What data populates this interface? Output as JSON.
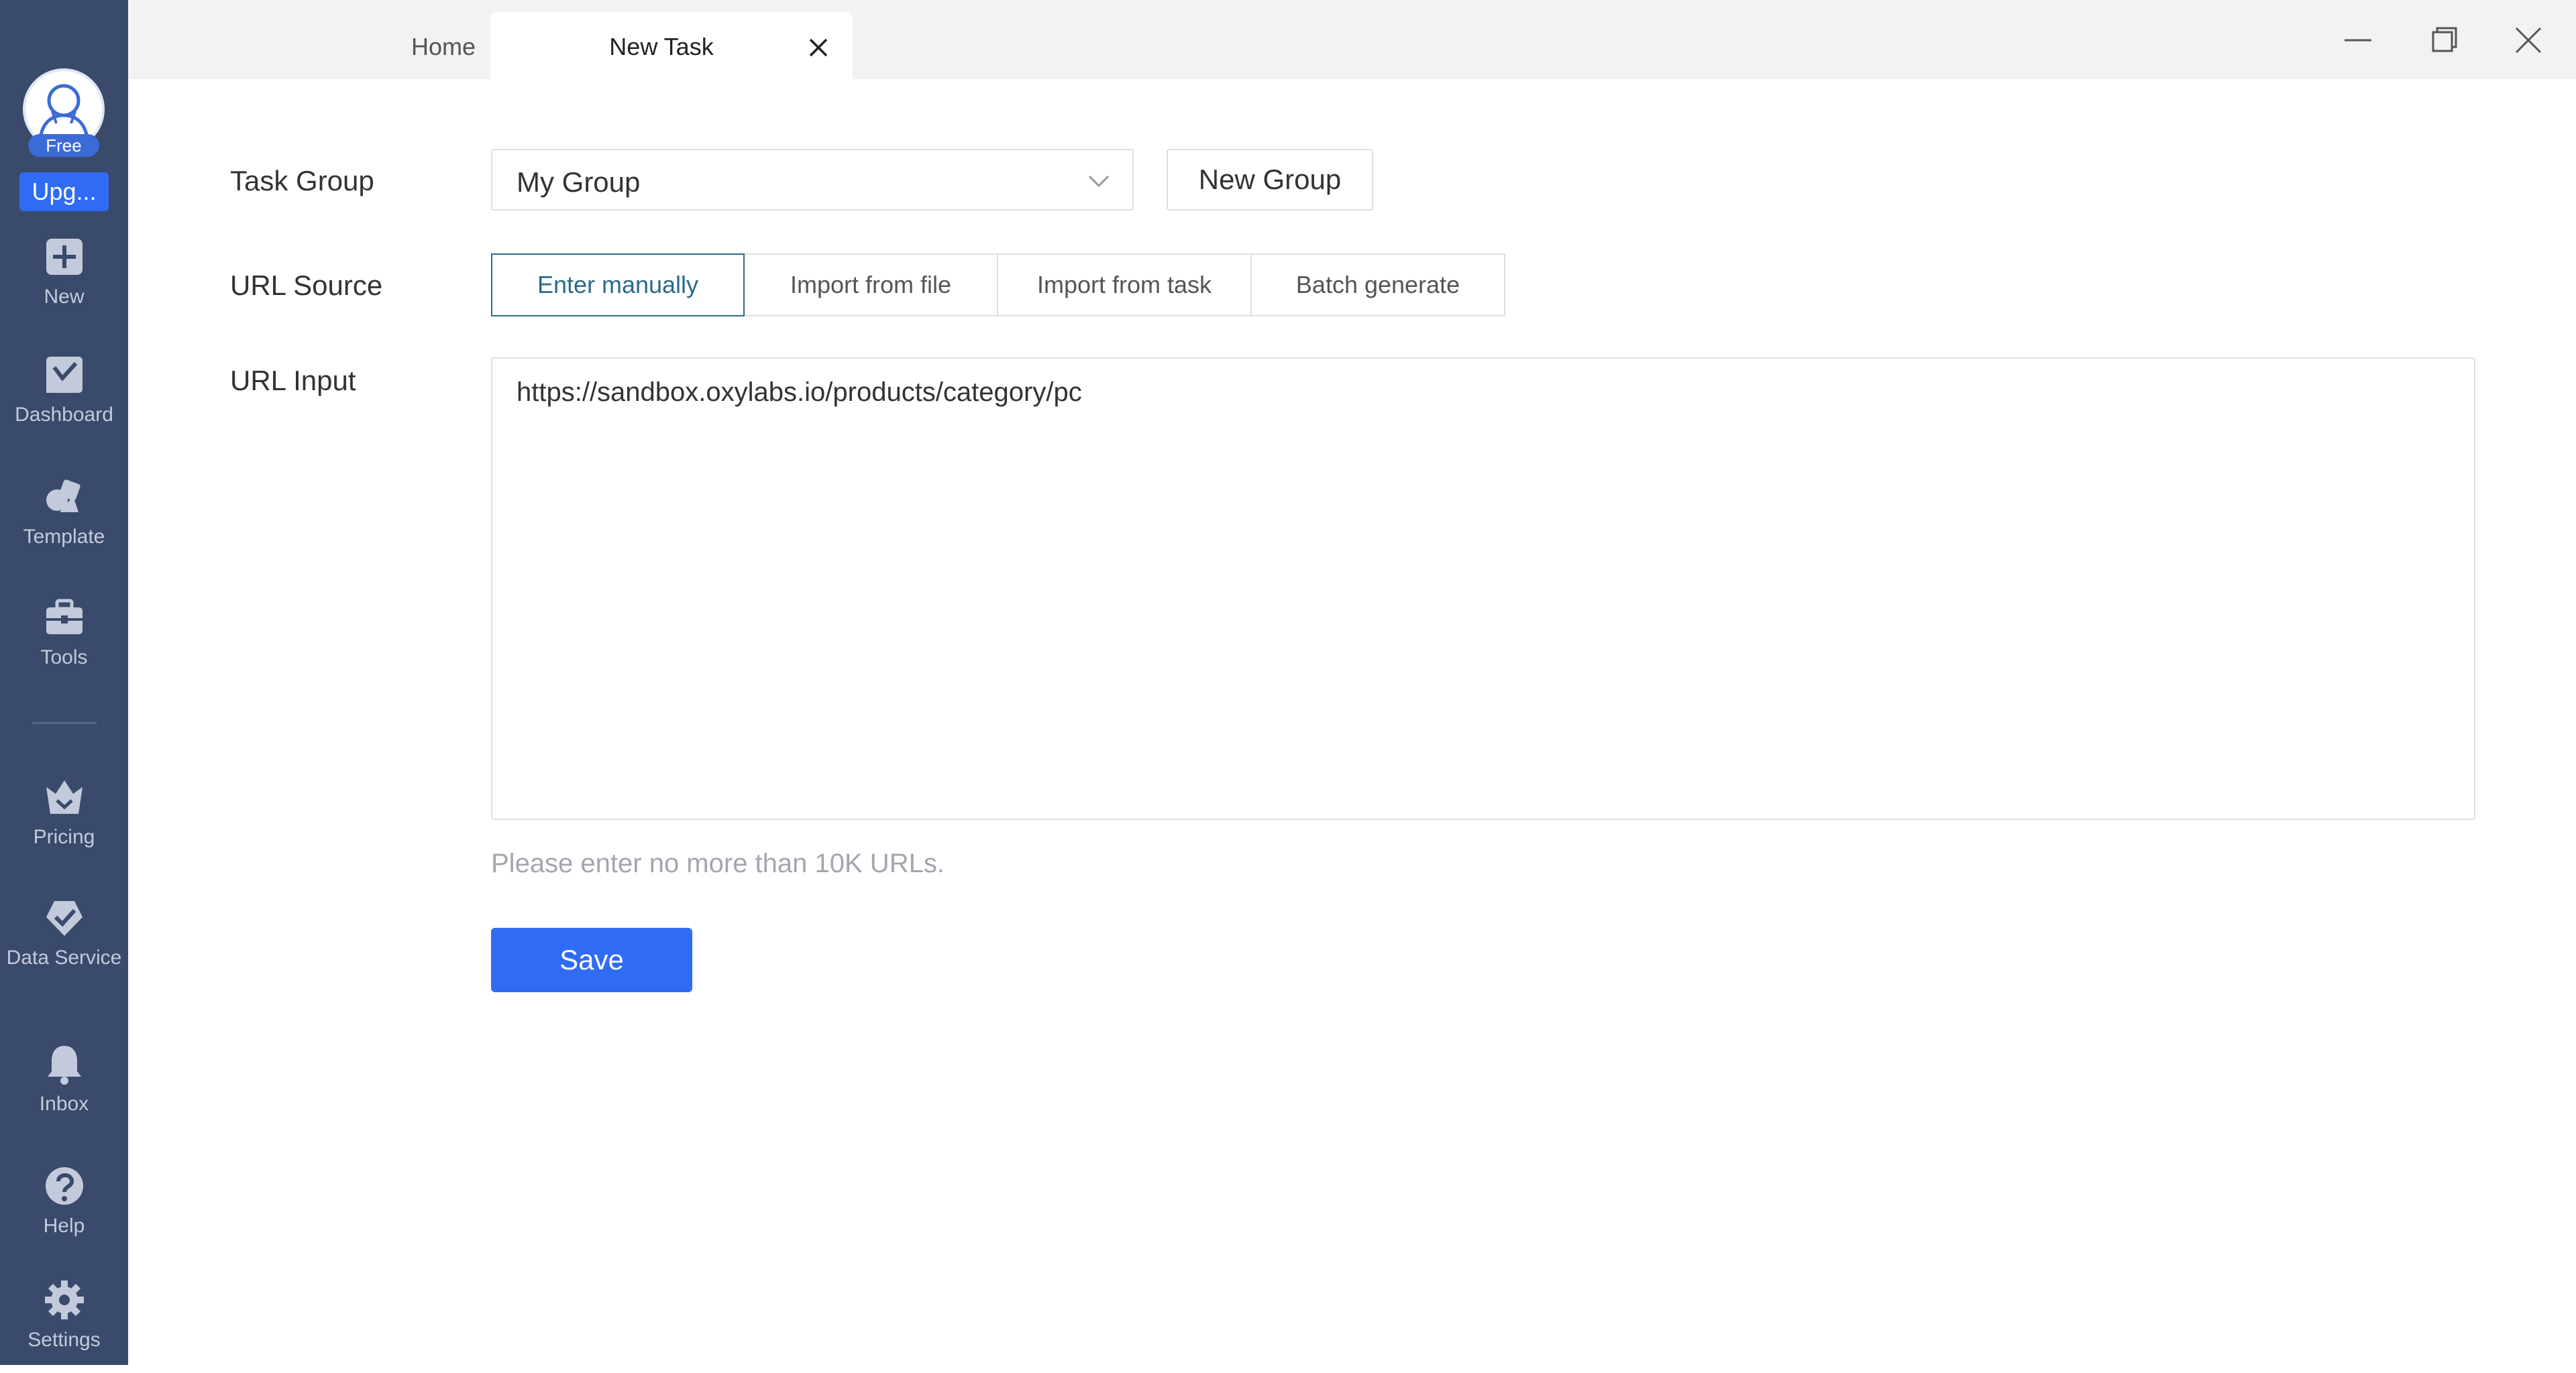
{
  "sidebar": {
    "free_badge": "Free",
    "upgrade_label": "Upg...",
    "items": [
      {
        "label": "New",
        "icon": "plus-square-icon"
      },
      {
        "label": "Dashboard",
        "icon": "dashboard-icon"
      },
      {
        "label": "Template",
        "icon": "template-icon"
      },
      {
        "label": "Tools",
        "icon": "toolbox-icon"
      },
      {
        "label": "Pricing",
        "icon": "crown-icon"
      },
      {
        "label": "Data Service",
        "icon": "heart-check-icon"
      },
      {
        "label": "Inbox",
        "icon": "bell-icon"
      },
      {
        "label": "Help",
        "icon": "question-icon"
      },
      {
        "label": "Settings",
        "icon": "gear-icon"
      }
    ]
  },
  "tabs": [
    {
      "label": "Home",
      "active": false
    },
    {
      "label": "New Task",
      "active": true
    }
  ],
  "form": {
    "task_group": {
      "label": "Task Group",
      "value": "My Group",
      "new_group_label": "New Group"
    },
    "url_source": {
      "label": "URL Source",
      "options": [
        "Enter manually",
        "Import from file",
        "Import from task",
        "Batch generate"
      ],
      "selected": "Enter manually"
    },
    "url_input": {
      "label": "URL Input",
      "value": "https://sandbox.oxylabs.io/products/category/pc"
    },
    "hint": "Please enter no more than 10K URLs.",
    "save_label": "Save"
  },
  "colors": {
    "sidebar_bg": "#3a4a6b",
    "primary": "#2f6bf5",
    "active_segment": "#2a6a8c"
  }
}
